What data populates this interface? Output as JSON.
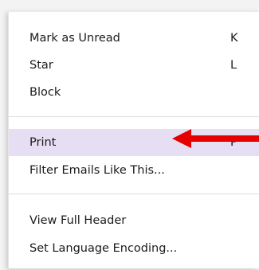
{
  "context_menu": {
    "items": [
      {
        "label": "Mark as Unread",
        "shortcut": "K"
      },
      {
        "label": "Star",
        "shortcut": "L"
      },
      {
        "label": "Block",
        "shortcut": ""
      },
      {
        "label": "Print",
        "shortcut": "P"
      },
      {
        "label": "Filter Emails Like This...",
        "shortcut": ""
      },
      {
        "label": "View Full Header",
        "shortcut": ""
      },
      {
        "label": "Set Language Encoding...",
        "shortcut": ""
      }
    ],
    "highlighted_item": "Print"
  },
  "annotation": {
    "icon": "red-arrow-left-icon",
    "color": "#e50000"
  },
  "colors": {
    "highlight": "#e6def2",
    "text": "#1b1b1b",
    "separator": "#dcdcdc"
  }
}
